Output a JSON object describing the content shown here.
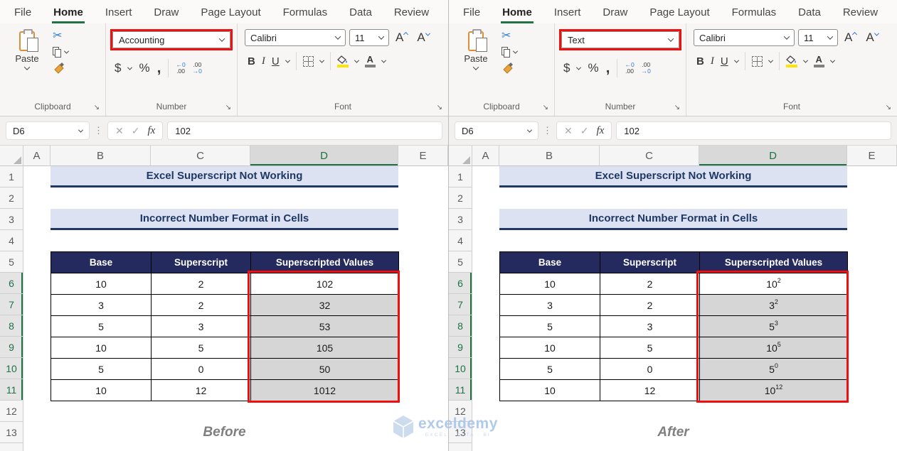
{
  "tabs": [
    "File",
    "Home",
    "Insert",
    "Draw",
    "Page Layout",
    "Formulas",
    "Data",
    "Review"
  ],
  "active_tab": "Home",
  "ribbon": {
    "paste_label": "Paste",
    "groups": {
      "clipboard": "Clipboard",
      "number": "Number",
      "font": "Font"
    },
    "font_name": "Calibri",
    "font_size": "11"
  },
  "icons": {
    "cut": "✂",
    "launcher": "↘",
    "dots": "⋮",
    "cancel": "✕",
    "check": "✓",
    "fx": "fx",
    "dollar": "$",
    "percent": "%",
    "comma": ",",
    "inc_dec_top": "←0",
    "inc_dec_bot": ".00",
    "dec_dec_top": ".00",
    "dec_dec_bot": "→0",
    "bold": "B",
    "italic": "I",
    "underline": "U",
    "font_size_grow": "A",
    "font_size_shrink": "A",
    "font_color": "A"
  },
  "formula_bar": {
    "name_box": "D6",
    "formula": "102"
  },
  "sheet": {
    "columns": [
      "A",
      "B",
      "C",
      "D",
      "E"
    ],
    "rows": [
      "1",
      "2",
      "3",
      "4",
      "5",
      "6",
      "7",
      "8",
      "9",
      "10",
      "11",
      "12",
      "13"
    ],
    "title": "Excel Superscript Not Working",
    "subtitle": "Incorrect Number Format in Cells"
  },
  "table": {
    "headers": [
      "Base",
      "Superscript",
      "Superscripted Values"
    ],
    "rows": [
      {
        "base": "10",
        "exp": "2",
        "before": "102"
      },
      {
        "base": "3",
        "exp": "2",
        "before": "32"
      },
      {
        "base": "5",
        "exp": "3",
        "before": "53"
      },
      {
        "base": "10",
        "exp": "5",
        "before": "105"
      },
      {
        "base": "5",
        "exp": "0",
        "before": "50"
      },
      {
        "base": "10",
        "exp": "12",
        "before": "1012"
      }
    ]
  },
  "panels": [
    {
      "number_format": "Accounting",
      "caption": "Before"
    },
    {
      "number_format": "Text",
      "caption": "After"
    }
  ],
  "watermark": {
    "name": "exceldemy",
    "tagline": "EXCEL · DATA · BI"
  },
  "colors": {
    "accent_green": "#217346",
    "selection_red": "#F10E0E",
    "header_navy": "#252A5E",
    "banner_lavender": "#DCE2F2",
    "banner_text": "#1F3864",
    "selected_cell_gray": "#D6D6D6"
  }
}
